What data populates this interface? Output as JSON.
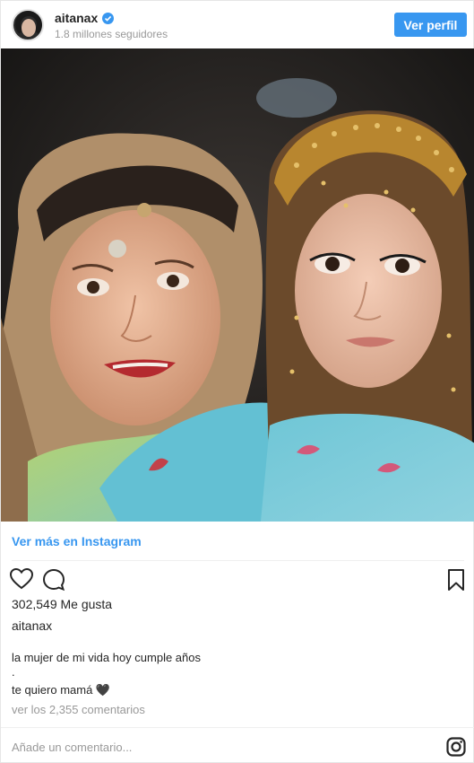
{
  "header": {
    "username": "aitanax",
    "followers": "1.8 millones seguidores",
    "profile_button": "Ver perfil"
  },
  "post": {
    "photo_description": "",
    "view_more": "Ver más en Instagram",
    "likes": "302,549 Me gusta",
    "caption_user": "aitanax",
    "caption_lines": [
      "la mujer de mi vida hoy cumple años",
      ".",
      "te quiero mamá 🖤"
    ],
    "view_comments": "ver los 2,355 comentarios",
    "add_comment_placeholder": "Añade un comentario..."
  },
  "icons": {
    "verified": "verified-badge-icon",
    "heart": "heart-icon",
    "comment": "comment-icon",
    "save": "bookmark-icon",
    "instagram": "instagram-icon"
  },
  "colors": {
    "accent": "#3897f0",
    "muted": "#999999",
    "text": "#262626"
  }
}
